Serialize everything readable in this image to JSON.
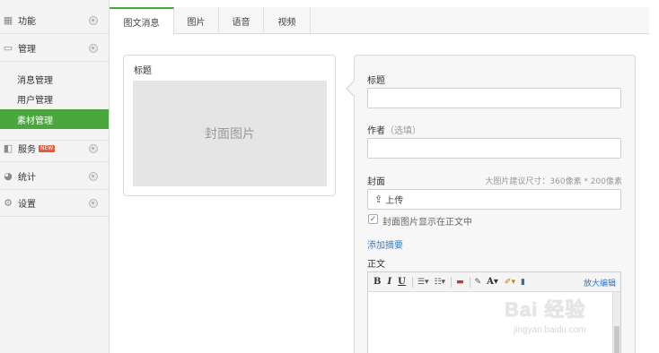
{
  "sidebar": {
    "items": [
      {
        "label": "功能",
        "icon": "grid-icon"
      },
      {
        "label": "管理",
        "icon": "folder-icon"
      },
      {
        "label": "服务",
        "icon": "service-icon",
        "badge": "NEW"
      },
      {
        "label": "统计",
        "icon": "pie-chart-icon"
      },
      {
        "label": "设置",
        "icon": "gear-icon"
      }
    ],
    "sub_items": [
      "消息管理",
      "用户管理",
      "素材管理"
    ],
    "active_sub": "素材管理",
    "accent": "#4ca640"
  },
  "tabs": [
    "图文消息",
    "图片",
    "语音",
    "视频"
  ],
  "active_tab": "图文消息",
  "preview": {
    "title": "标题",
    "cover_placeholder": "封面图片"
  },
  "form": {
    "title_label": "标题",
    "author_label": "作者",
    "author_hint": "（选填）",
    "cover_label": "封面",
    "cover_size_tip": "大图片建议尺寸：360像素 * 200像素",
    "upload_label": "上传",
    "show_cover_label": "封面图片显示在正文中",
    "show_cover_checked": true,
    "add_summary_link": "添加摘要",
    "body_label": "正文"
  },
  "editor": {
    "bold": "B",
    "italic": "I",
    "underline": "U",
    "font_label": "A",
    "fullscreen_label": "放大编辑"
  },
  "watermark": {
    "logo": "Bai 经验",
    "url": "jingyan.baidu.com"
  }
}
